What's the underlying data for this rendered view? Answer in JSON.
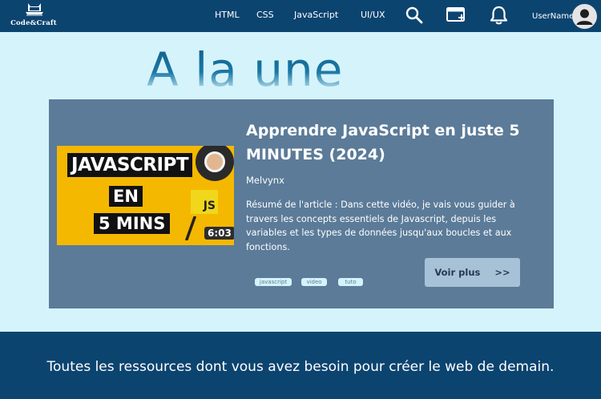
{
  "brand": {
    "name": "Code&Craft",
    "logo_icon": "laptop-with-cat-ears-icon"
  },
  "nav": {
    "links": [
      {
        "label": "HTML"
      },
      {
        "label": "CSS"
      },
      {
        "label": "JavaScript"
      },
      {
        "label": "UI/UX"
      }
    ],
    "icons": [
      "search-icon",
      "new-window-icon",
      "bell-icon"
    ],
    "username": "UserName"
  },
  "hero": {
    "title": "A la une"
  },
  "article": {
    "title": "Apprendre JavaScript en juste 5 MINUTES (2024)",
    "author": "Melvynx",
    "summary": "Résumé de l'article : Dans cette vidéo, je vais vous guider à travers les concepts essentiels de Javascript, depuis les variables et les types de données jusqu'aux boucles et aux fonctions.",
    "thumbnail": {
      "line1": "JAVASCRIPT",
      "line2": "EN",
      "line3": "5 MINS",
      "badge": "JS",
      "duration": "6:03"
    },
    "tags": [
      "javascript",
      "video",
      "tuto"
    ],
    "cta": {
      "label": "Voir plus",
      "arrow": ">>"
    }
  },
  "footer": {
    "tagline": "Toutes les ressources dont vous avez besoin pour créer le web de demain."
  },
  "colors": {
    "navbar": "#0c4470",
    "page_bg": "#d5f3fb",
    "card_bg": "#5b7b98",
    "button_bg": "#a7c2d6",
    "thumbnail_bg": "#f5b800"
  }
}
